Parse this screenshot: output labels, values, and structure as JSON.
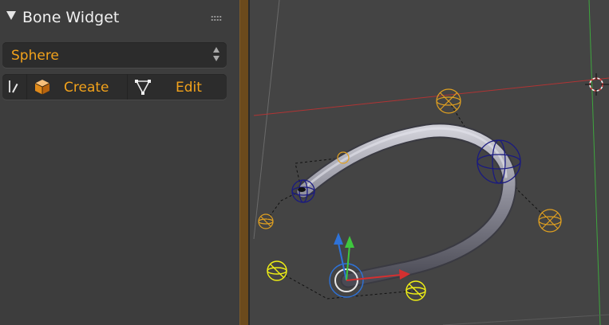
{
  "panel": {
    "title": "Bone Widget",
    "dropdown": {
      "selected": "Sphere"
    },
    "buttons": {
      "create_label": "Create",
      "edit_label": "Edit"
    }
  },
  "colors": {
    "accent": "#f2a21b",
    "panel_bg": "#3d3d3d",
    "widget_bg": "#2c2c2c",
    "divider": "#6b4a1c",
    "viewport_bg": "#444444",
    "x_axis": "#c13a3a",
    "y_axis": "#3ea63e",
    "z_axis": "#2e72d8",
    "control_yellow": "#e0a020",
    "control_blue": "#14147a",
    "selected_yellow": "#f0f014"
  },
  "icons": {
    "collapse": "triangle-down-icon",
    "grip": "drag-grip-icon",
    "toggle": "checkbox-edit-icon",
    "create": "cube-icon",
    "edit": "vertex-triangle-icon",
    "cursor": "3d-cursor-icon"
  }
}
